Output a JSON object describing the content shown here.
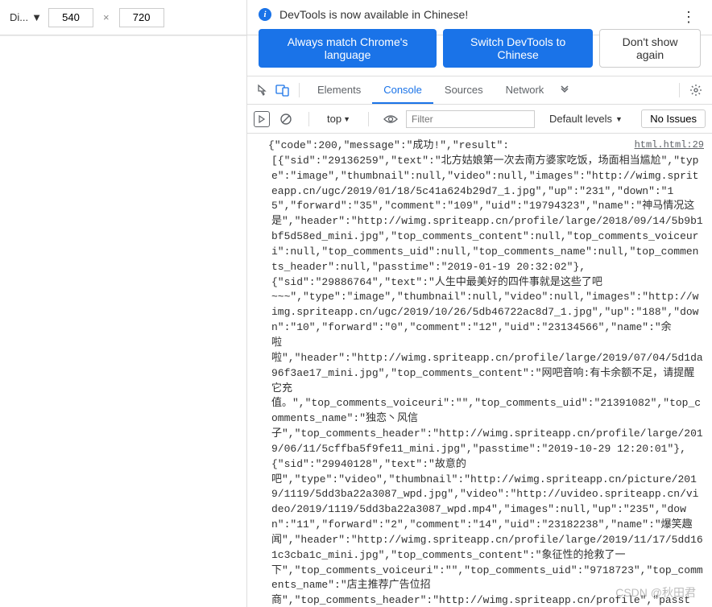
{
  "device": {
    "label": "Di...",
    "width": "540",
    "height": "720"
  },
  "notice": {
    "text": "DevTools is now available in Chinese!",
    "btn_match": "Always match Chrome's language",
    "btn_switch": "Switch DevTools to Chinese",
    "btn_dont": "Don't show again"
  },
  "tabs": {
    "elements": "Elements",
    "console": "Console",
    "sources": "Sources",
    "network": "Network"
  },
  "filter": {
    "context": "top",
    "placeholder": "Filter",
    "levels": "Default levels",
    "issues": "No Issues"
  },
  "source_link": "html.html:29",
  "console_log": "{\"code\":200,\"message\":\"成功!\",\"result\":\n[{\"sid\":\"29136259\",\"text\":\"北方姑娘第一次去南方婆家吃饭，场面相当尴尬\",\"type\":\"image\",\"thumbnail\":null,\"video\":null,\"images\":\"http://wimg.spriteapp.cn/ugc/2019/01/18/5c41a624b29d7_1.jpg\",\"up\":\"231\",\"down\":\"15\",\"forward\":\"35\",\"comment\":\"109\",\"uid\":\"19794323\",\"name\":\"神马情况这\n是\",\"header\":\"http://wimg.spriteapp.cn/profile/large/2018/09/14/5b9b1bf5d58ed_mini.jpg\",\"top_comments_content\":null,\"top_comments_voiceuri\":null,\"top_comments_uid\":null,\"top_comments_name\":null,\"top_comments_header\":null,\"passtime\":\"2019-01-19 20:32:02\"},\n{\"sid\":\"29886764\",\"text\":\"人生中最美好的四件事就是这些了吧\n~~~\",\"type\":\"image\",\"thumbnail\":null,\"video\":null,\"images\":\"http://wimg.spriteapp.cn/ugc/2019/10/26/5db46722ac8d7_1.jpg\",\"up\":\"188\",\"down\":\"10\",\"forward\":\"0\",\"comment\":\"12\",\"uid\":\"23134566\",\"name\":\"余\n啦\n啦\",\"header\":\"http://wimg.spriteapp.cn/profile/large/2019/07/04/5d1da96f3ae17_mini.jpg\",\"top_comments_content\":\"网吧音响:有卡余额不足，请提醒它充\n值。\",\"top_comments_voiceuri\":\"\",\"top_comments_uid\":\"21391082\",\"top_comments_name\":\"独恋丶风信\n子\",\"top_comments_header\":\"http://wimg.spriteapp.cn/profile/large/2019/06/11/5cffba5f9fe11_mini.jpg\",\"passtime\":\"2019-10-29 12:20:01\"},{\"sid\":\"29940128\",\"text\":\"故意的\n吧\",\"type\":\"video\",\"thumbnail\":\"http://wimg.spriteapp.cn/picture/2019/1119/5dd3ba22a3087_wpd.jpg\",\"video\":\"http://uvideo.spriteapp.cn/video/2019/1119/5dd3ba22a3087_wpd.mp4\",\"images\":null,\"up\":\"235\",\"down\":\"11\",\"forward\":\"2\",\"comment\":\"14\",\"uid\":\"23182238\",\"name\":\"爆笑趣\n闻\",\"header\":\"http://wimg.spriteapp.cn/profile/large/2019/11/17/5dd161c3cba1c_mini.jpg\",\"top_comments_content\":\"象征性的抢救了一\n下\",\"top_comments_voiceuri\":\"\",\"top_comments_uid\":\"9718723\",\"top_comments_name\":\"店主推荐广告位招\n商\",\"top_comments_header\":\"http://wimg.spriteapp.cn/profile\",\"passt",
  "watermark": "CSDN @秋田君"
}
